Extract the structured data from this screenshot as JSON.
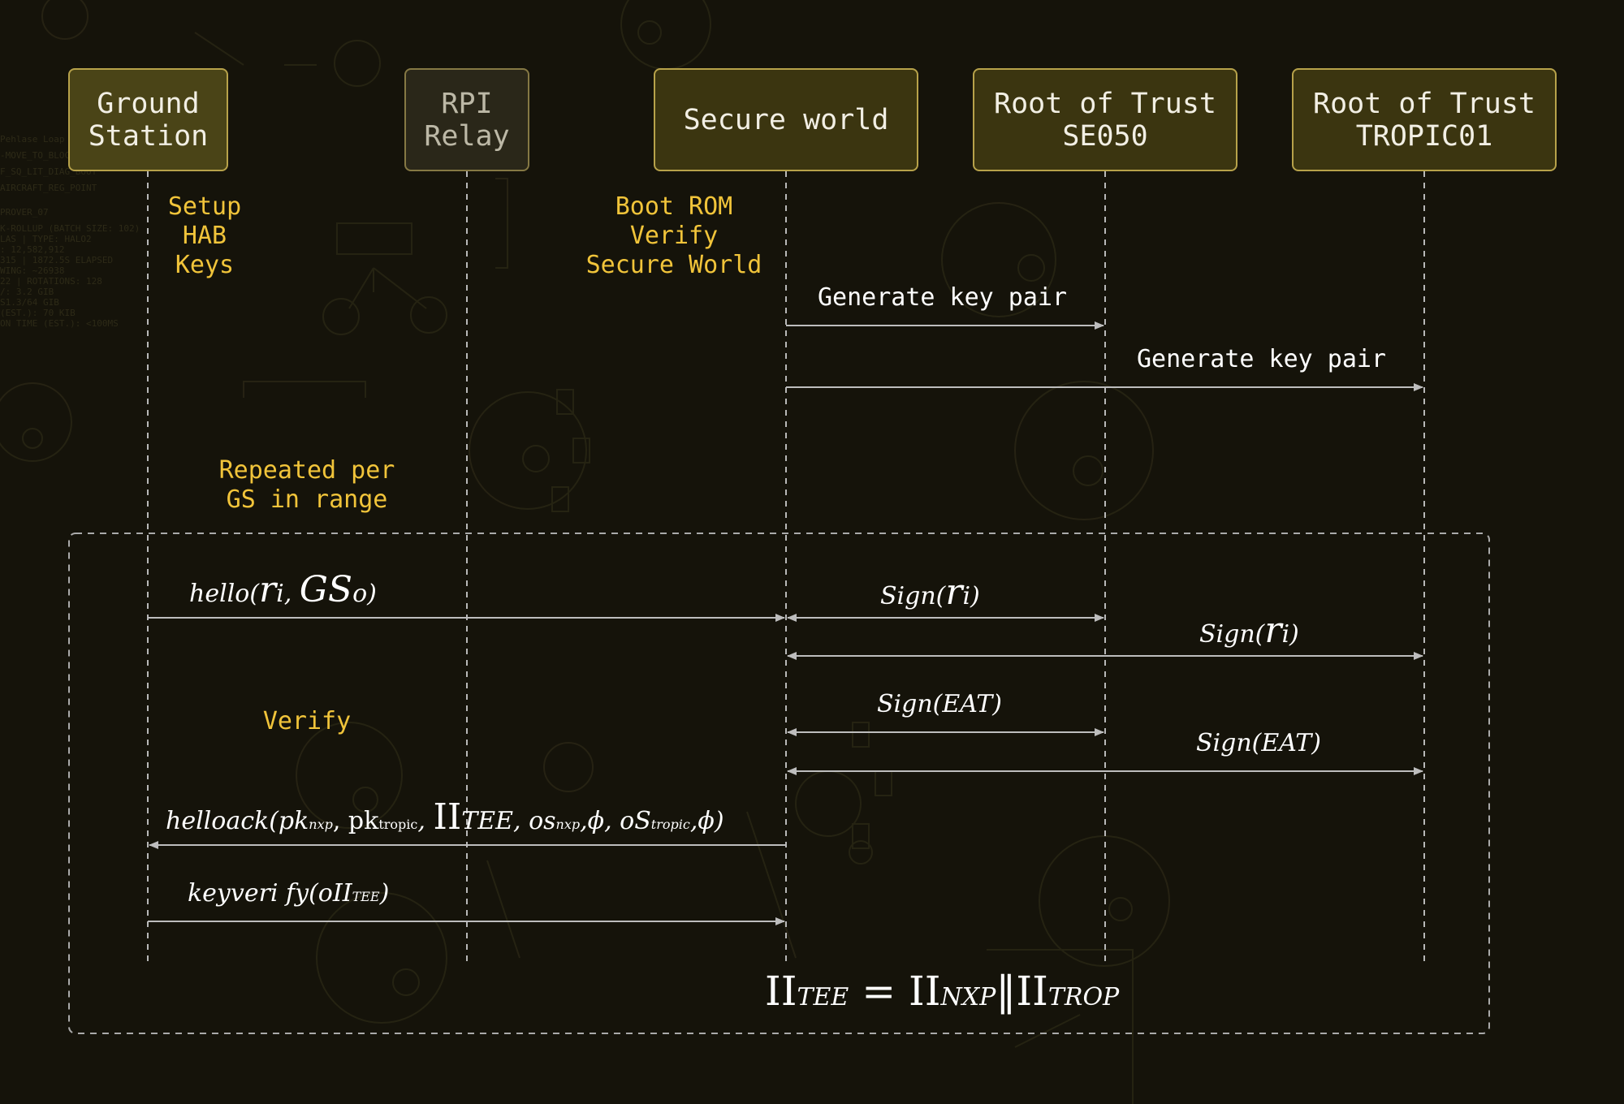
{
  "actors": [
    {
      "id": "gs",
      "label": "Ground\nStation"
    },
    {
      "id": "relay",
      "label": "RPI\nRelay"
    },
    {
      "id": "secure",
      "label": "Secure world"
    },
    {
      "id": "se050",
      "label": "Root of Trust\nSE050"
    },
    {
      "id": "tropic",
      "label": "Root of Trust\nTROPIC01"
    }
  ],
  "notes": {
    "setup": "Setup\nHAB\nKeys",
    "boot": "Boot ROM\nVerify\nSecure World",
    "repeated": "Repeated per\nGS in range",
    "verify": "Verify"
  },
  "messages": {
    "gen_se050": "Generate key pair",
    "gen_tropic": "Generate key pair",
    "hello": {
      "fn": "hello(",
      "r": "r",
      "r_sub": "i",
      "sep": ", ",
      "gs": "GS",
      "gs_sub": "o",
      "close": ")"
    },
    "sign_r_se050": {
      "fn": "Sign(",
      "r": "r",
      "r_sub": "i",
      "close": ")"
    },
    "sign_r_tropic": {
      "fn": "Sign(",
      "r": "r",
      "r_sub": "i",
      "close": ")"
    },
    "sign_eat_se050": "Sign(EAT)",
    "sign_eat_tropic": "Sign(EAT)",
    "helloack": {
      "fn": "helloack(pk",
      "pk1_sub": "nxp",
      "sep1": ", pk",
      "pk2_sub": "tropic",
      "sep2": ", ",
      "pi": "II",
      "pi_sub": "TEE",
      "sep3": ", os",
      "os1_sub": "nxp",
      "phi1": ",ϕ, oS",
      "os2_sub": "tropic",
      "phi2": ",ϕ)"
    },
    "keyverify": {
      "fn": "keyveri fy(oII",
      "sub": "TEE",
      "close": ")"
    }
  },
  "formula": {
    "pi": "II",
    "tee": "TEE",
    "eq": " = ",
    "nxp": "NXP",
    "sep": "‖",
    "trop": "TROP"
  },
  "colors": {
    "background": "#15130a",
    "note": "#f1c43a",
    "arrow": "#bdbdbd",
    "lifeline": "#b8b8b8",
    "actor_border": "#b7a24a",
    "actor_fill": "#3b3510"
  }
}
